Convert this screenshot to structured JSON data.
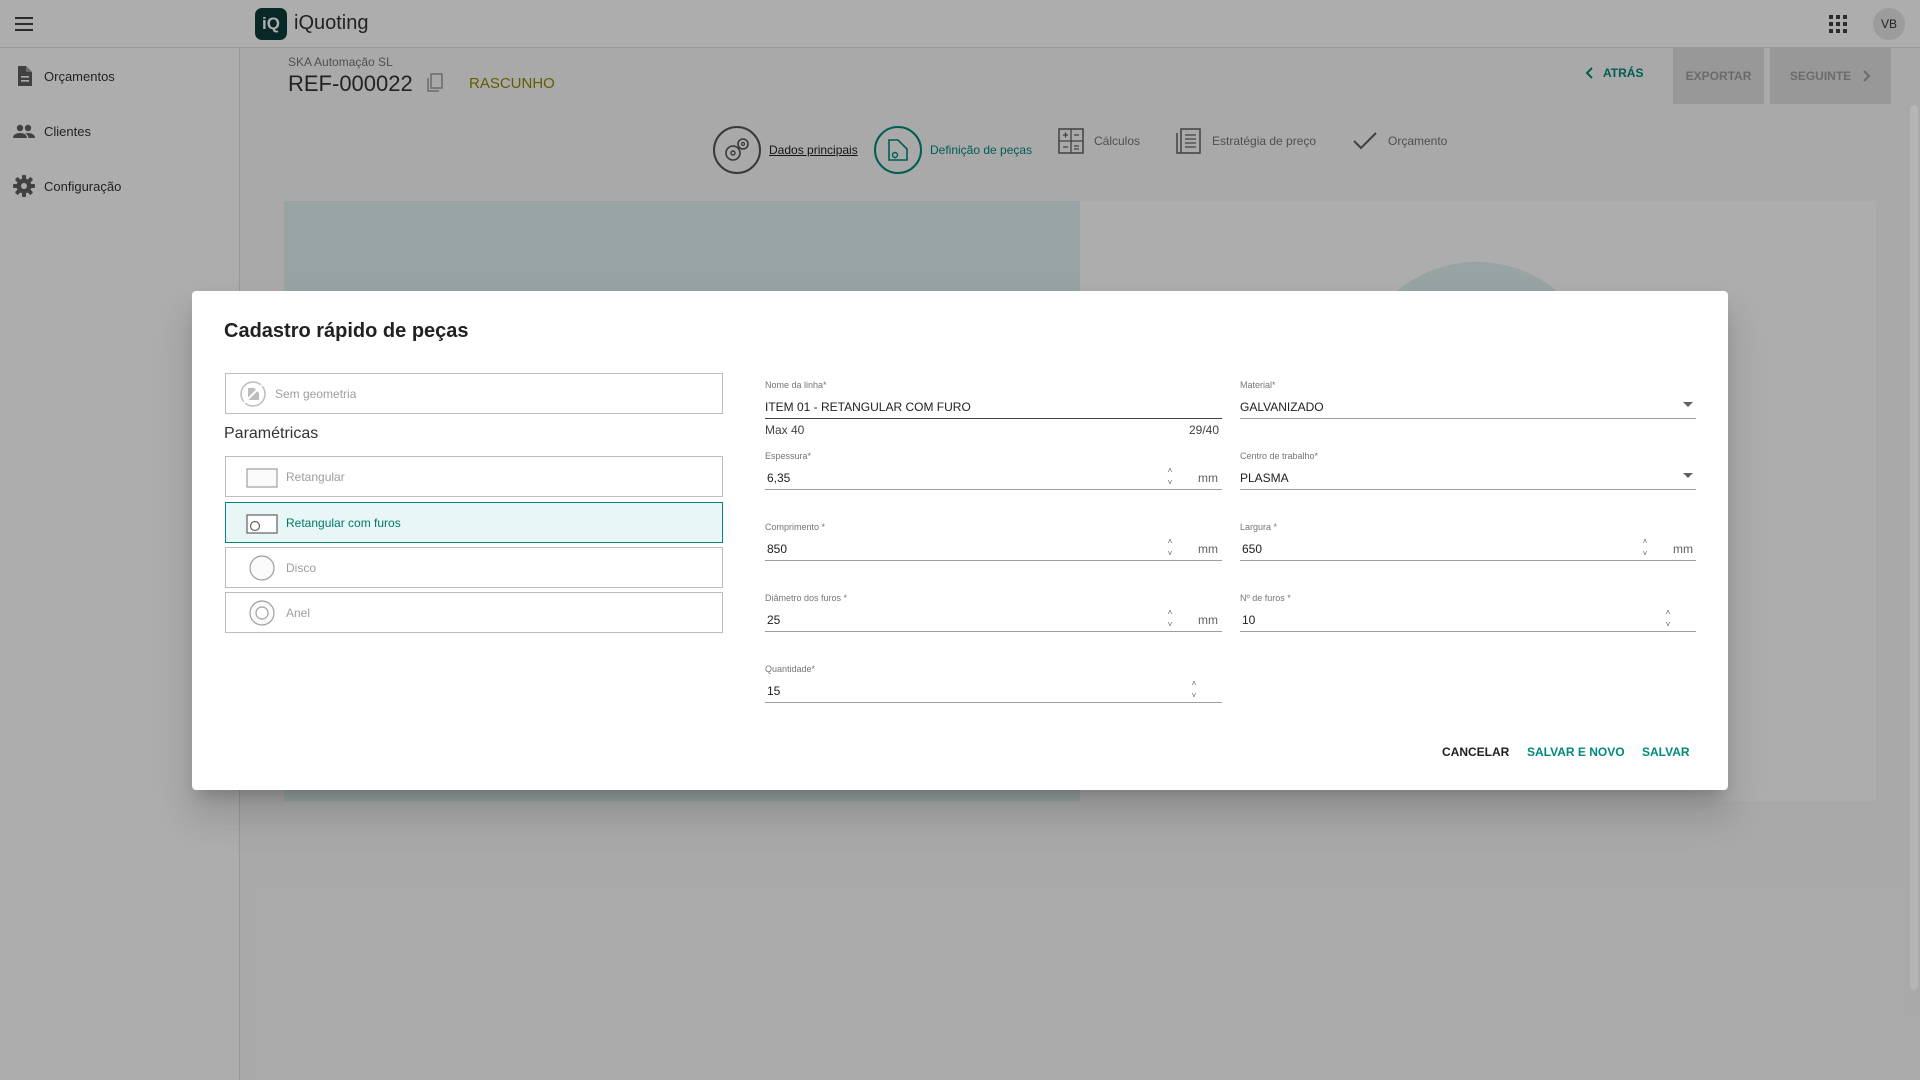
{
  "app": {
    "logo_text": "iQ",
    "title": "iQuoting",
    "user_initials": "VB"
  },
  "sidebar": {
    "items": [
      {
        "label": "Orçamentos",
        "icon": "document-icon"
      },
      {
        "label": "Clientes",
        "icon": "people-icon"
      },
      {
        "label": "Configuração",
        "icon": "gear-icon"
      }
    ]
  },
  "header": {
    "company": "SKA Automação SL",
    "reference": "REF-000022",
    "status": "RASCUNHO",
    "back_label": "ATRÁS",
    "export_label": "EXPORTAR",
    "next_label": "SEGUINTE"
  },
  "stepper": {
    "steps": [
      {
        "label": "Dados principais",
        "state": "done"
      },
      {
        "label": "Definição de peças",
        "state": "active"
      },
      {
        "label": "Cálculos",
        "state": "pending"
      },
      {
        "label": "Estratégia de preço",
        "state": "pending"
      },
      {
        "label": "Orçamento",
        "state": "pending"
      }
    ]
  },
  "dialog": {
    "title": "Cadastro rápido de peças",
    "no_geometry_label": "Sem geometria",
    "parametric_title": "Paramétricas",
    "geometries": [
      {
        "label": "Retangular",
        "selected": false
      },
      {
        "label": "Retangular com furos",
        "selected": true
      },
      {
        "label": "Disco",
        "selected": false
      },
      {
        "label": "Anel",
        "selected": false
      }
    ],
    "fields": {
      "line_name": {
        "label": "Nome da linha*",
        "value": "ITEM 01 - RETANGULAR COM FURO",
        "hint": "Max 40",
        "counter": "29/40"
      },
      "material": {
        "label": "Material*",
        "value": "GALVANIZADO"
      },
      "thickness": {
        "label": "Espessura*",
        "value": "6,35",
        "unit": "mm"
      },
      "work_center": {
        "label": "Centro de trabalho*",
        "value": "PLASMA"
      },
      "length": {
        "label": "Comprimento *",
        "value": "850",
        "unit": "mm"
      },
      "width": {
        "label": "Largura *",
        "value": "650",
        "unit": "mm"
      },
      "hole_diameter": {
        "label": "Diâmetro dos furos *",
        "value": "25",
        "unit": "mm"
      },
      "hole_count": {
        "label": "Nº de furos *",
        "value": "10"
      },
      "quantity": {
        "label": "Quantidade*",
        "value": "15"
      }
    },
    "actions": {
      "cancel": "CANCELAR",
      "save_new": "SALVAR E NOVO",
      "save": "SALVAR"
    }
  },
  "colors": {
    "accent": "#00897b",
    "status": "#8d8d00",
    "logo_bg": "#0c3b3a"
  }
}
